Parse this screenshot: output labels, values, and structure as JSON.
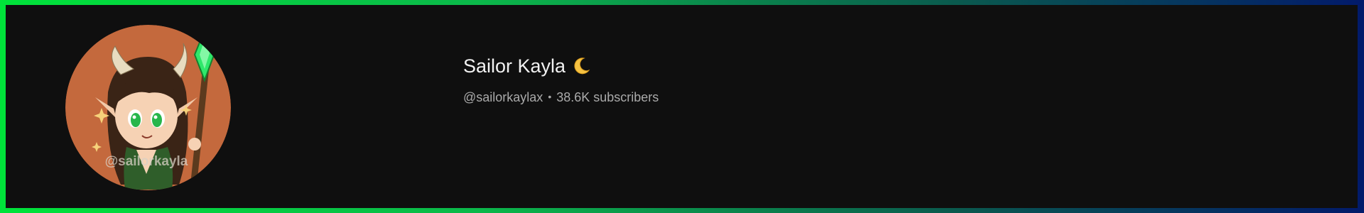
{
  "channel": {
    "name": "Sailor Kayla",
    "name_emoji_icon": "crescent-moon-icon",
    "handle": "@sailorkaylax",
    "separator": "•",
    "subscribers": "38.6K subscribers"
  },
  "avatar": {
    "icon": "channel-avatar",
    "watermark_text": "@sailorkayla"
  },
  "colors": {
    "background": "#0f0f0f",
    "border_start": "#00e33a",
    "border_end": "#021a6b",
    "name_text": "#f1f1f1",
    "meta_text": "#aaaaaa",
    "avatar_bg": "#c4693d"
  }
}
